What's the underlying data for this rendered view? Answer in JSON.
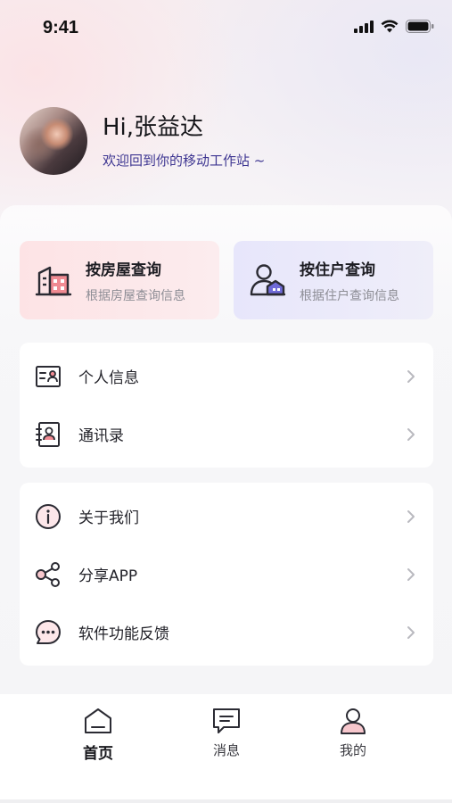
{
  "status_bar": {
    "time": "9:41"
  },
  "profile": {
    "greeting": "Hi,张益达",
    "welcome": "欢迎回到你的移动工作站 ~"
  },
  "quick_actions": [
    {
      "title": "按房屋查询",
      "subtitle": "根据房屋查询信息",
      "icon": "building-icon"
    },
    {
      "title": "按住户查询",
      "subtitle": "根据住户查询信息",
      "icon": "resident-icon"
    }
  ],
  "menu_group_1": [
    {
      "label": "个人信息",
      "icon": "profile-card-icon"
    },
    {
      "label": "通讯录",
      "icon": "contacts-icon"
    }
  ],
  "menu_group_2": [
    {
      "label": "关于我们",
      "icon": "info-icon"
    },
    {
      "label": "分享APP",
      "icon": "share-icon"
    },
    {
      "label": "软件功能反馈",
      "icon": "feedback-icon"
    }
  ],
  "tabbar": {
    "home": "首页",
    "messages": "消息",
    "mine": "我的",
    "active": "home"
  },
  "colors": {
    "accent": "#3d3591",
    "house_card": "#fde3e5",
    "resident_card": "#e7e6fb"
  }
}
